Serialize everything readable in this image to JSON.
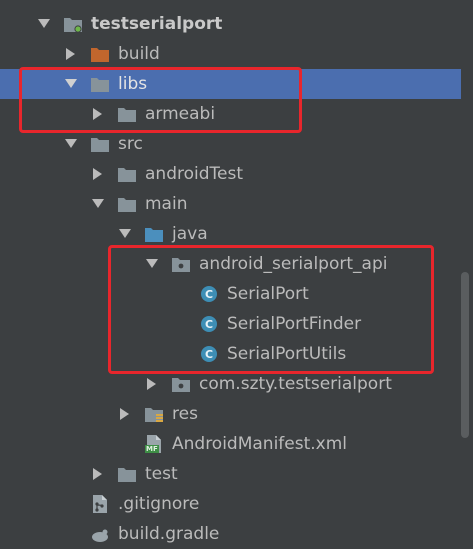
{
  "project_tree": {
    "root": {
      "label": "testserialport"
    },
    "items": [
      {
        "label": "build"
      },
      {
        "label": "libs"
      },
      {
        "label": "armeabi"
      },
      {
        "label": "src"
      },
      {
        "label": "androidTest"
      },
      {
        "label": "main"
      },
      {
        "label": "java"
      },
      {
        "label": "android_serialport_api"
      },
      {
        "label": "SerialPort",
        "badge": "C"
      },
      {
        "label": "SerialPortFinder",
        "badge": "C"
      },
      {
        "label": "SerialPortUtils",
        "badge": "C"
      },
      {
        "label": "com.szty.testserialport"
      },
      {
        "label": "res"
      },
      {
        "label": "AndroidManifest.xml",
        "badge": "MF"
      },
      {
        "label": "test"
      },
      {
        "label": ".gitignore"
      },
      {
        "label": "build.gradle"
      }
    ]
  },
  "colors": {
    "background": "#3c3f41",
    "selection": "#4b6eaf",
    "highlight_box": "#e8262c",
    "folder": "#87939a",
    "excluded_folder": "#c1662d",
    "source_folder": "#4b8fbd",
    "class_icon": "#3d8eb5"
  },
  "icons": {
    "expanded": "triangle-down-icon",
    "collapsed": "triangle-right-icon",
    "folder": "folder-icon",
    "package": "package-folder-icon",
    "class": "class-c-icon",
    "manifest": "manifest-file-icon",
    "resources": "resources-folder-icon",
    "gitignore": "git-file-icon",
    "gradle": "gradle-file-icon"
  }
}
